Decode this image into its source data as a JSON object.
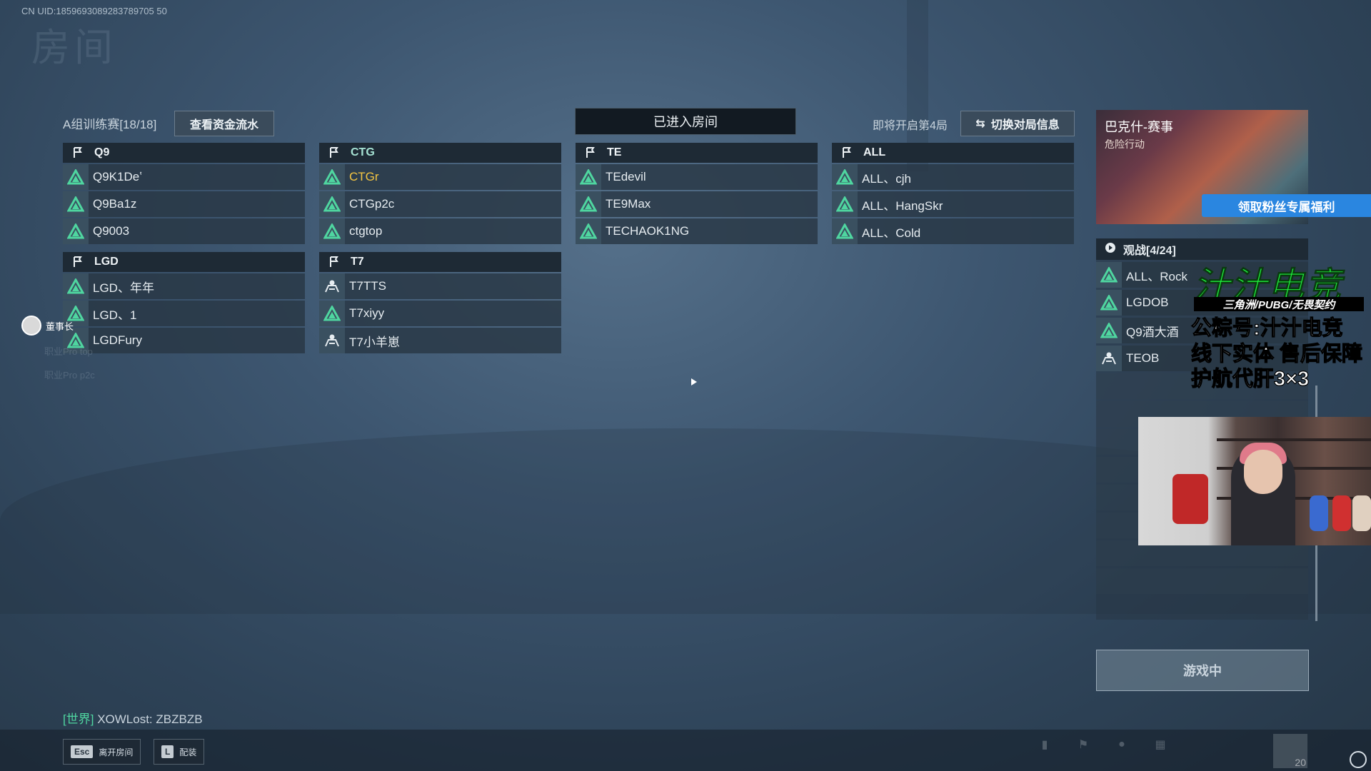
{
  "uid": "CN UID:1859693089283789705 50",
  "faint_title": "房间",
  "header": {
    "group_label": "A组训练赛[18/18]",
    "flow_button": "查看资金流水",
    "entered_room": "已进入房间",
    "next_round": "即将开启第4局",
    "switch_button": "切换对局信息"
  },
  "teams": [
    {
      "name": "Q9",
      "players": [
        "Q9K1Deʽ",
        "Q9Ba1z",
        "Q9003"
      ]
    },
    {
      "name": "CTG",
      "players": [
        "CTGr",
        "CTGp2c",
        "ctgtop"
      ]
    },
    {
      "name": "TE",
      "players": [
        "TEdevil",
        "TE9Max",
        "TECHAOK1NG"
      ]
    },
    {
      "name": "ALL",
      "players": [
        "ALL、cjh",
        "ALL、HangSkr",
        "ALL、Cold"
      ]
    },
    {
      "name": "LGD",
      "players": [
        "LGD、年年",
        "LGD、1",
        "LGDFury"
      ]
    },
    {
      "name": "T7",
      "players": [
        "T7TTS",
        "T7xiyy",
        "T7小羊崽"
      ]
    }
  ],
  "host_badge": "董事长",
  "ghost_rows": [
    "职业Pro top",
    "职业Pro p2c"
  ],
  "promo": {
    "title": "巴克什-赛事",
    "subtitle": "危险行动",
    "button": "领取粉丝专属福利"
  },
  "spectators": {
    "title": "观战[4/24]",
    "list": [
      "ALL、Rock",
      "LGDOB",
      "Q9酒大酒",
      "TEOB"
    ]
  },
  "ad": {
    "title": "汁汁电竞",
    "sub": "三角洲/PUBG/无畏契约",
    "line1": "公粽号:汁汁电竞",
    "line2": "线下实体 售后保障",
    "line3": "护航代肝3×3"
  },
  "game_button": "游戏中",
  "chat": {
    "channel": "[世界]",
    "message": "XOWLost: ZBZBZB"
  },
  "hints": [
    {
      "key": "Esc",
      "label": "离开房间"
    },
    {
      "key": "L",
      "label": "配装"
    }
  ],
  "thumb_count": "20",
  "colors": {
    "accent_green": "#4fd6a0",
    "self_name": "#f4c542",
    "promo_blue": "#2a86e0",
    "ad_green": "#1ef03c"
  }
}
